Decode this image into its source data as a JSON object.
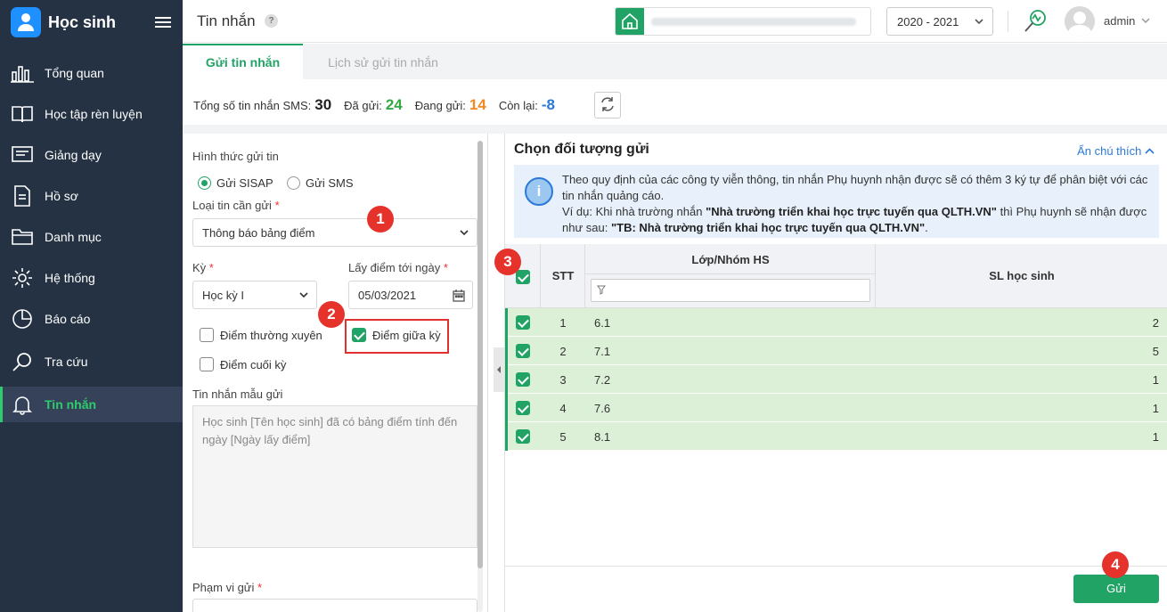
{
  "app": {
    "title": "Học sinh"
  },
  "sidebar": {
    "items": [
      {
        "label": "Tổng quan",
        "icon": "bar-chart-icon"
      },
      {
        "label": "Học tập rèn luyện",
        "icon": "book-icon"
      },
      {
        "label": "Giảng dạy",
        "icon": "blackboard-icon"
      },
      {
        "label": "Hồ sơ",
        "icon": "document-icon"
      },
      {
        "label": "Danh mục",
        "icon": "folder-icon"
      },
      {
        "label": "Hệ thống",
        "icon": "gear-icon"
      },
      {
        "label": "Báo cáo",
        "icon": "pie-chart-icon"
      },
      {
        "label": "Tra cứu",
        "icon": "search-icon"
      },
      {
        "label": "Tin nhắn",
        "icon": "bell-icon",
        "active": true
      }
    ]
  },
  "header": {
    "title": "Tin nhắn",
    "help": "?",
    "year": "2020 - 2021",
    "user": "admin"
  },
  "tabs": [
    {
      "label": "Gửi tin nhắn",
      "active": true
    },
    {
      "label": "Lịch sử gửi tin nhắn"
    }
  ],
  "stats": {
    "total_label": "Tổng số tin nhắn SMS:",
    "total": "30",
    "sent_label": "Đã gửi:",
    "sent": "24",
    "sending_label": "Đang gửi:",
    "sending": "14",
    "remaining_label": "Còn lại:",
    "remaining": "-8"
  },
  "form": {
    "send_method_label": "Hình thức gửi tin",
    "method_sisap": "Gửi SISAP",
    "method_sms": "Gửi SMS",
    "message_type_label": "Loại tin cần gửi",
    "message_type_value": "Thông báo bảng điểm",
    "term_label": "Kỳ",
    "term_value": "Học kỳ I",
    "date_label": "Lấy điểm tới ngày",
    "date_value": "05/03/2021",
    "chk_regular": "Điểm thường xuyên",
    "chk_midterm": "Điểm giữa kỳ",
    "chk_final": "Điểm cuối kỳ",
    "template_label": "Tin nhắn mẫu gửi",
    "template_text": "Học sinh [Tên học sinh] đã có bảng điểm tính đến ngày [Ngày lấy điểm]",
    "scope_label": "Phạm vi gửi",
    "required_mark": "*"
  },
  "recipients": {
    "title": "Chọn đối tượng gửi",
    "hide_hint": "Ẩn chú thích",
    "info_line1": "Theo quy định của các công ty viễn thông, tin nhắn Phụ huynh nhận được sẽ có thêm 3 ký tự để phân biệt với các tin nhắn quảng cáo.",
    "info_ex_prefix": "Ví dụ: Khi nhà trường nhắn ",
    "info_ex_quote1": "\"Nhà trường triển khai học trực tuyến qua QLTH.VN\"",
    "info_ex_mid": " thì Phụ huynh sẽ nhận được như sau: ",
    "info_ex_quote2": "\"TB: Nhà trường triển khai học trực tuyến qua QLTH.VN\"",
    "info_ex_end": ".",
    "columns": {
      "stt": "STT",
      "class": "Lớp/Nhóm HS",
      "count": "SL học sinh"
    },
    "rows": [
      {
        "stt": "1",
        "class": "6.1",
        "count": "2"
      },
      {
        "stt": "2",
        "class": "7.1",
        "count": "5"
      },
      {
        "stt": "3",
        "class": "7.2",
        "count": "1"
      },
      {
        "stt": "4",
        "class": "7.6",
        "count": "1"
      },
      {
        "stt": "5",
        "class": "8.1",
        "count": "1"
      }
    ],
    "send_button": "Gửi"
  },
  "annotations": [
    "1",
    "2",
    "3",
    "4"
  ],
  "colors": {
    "accent": "#21a366",
    "sidebar": "#253243",
    "badge": "#e5322b",
    "link": "#2a79d8",
    "sending": "#f08a24"
  }
}
